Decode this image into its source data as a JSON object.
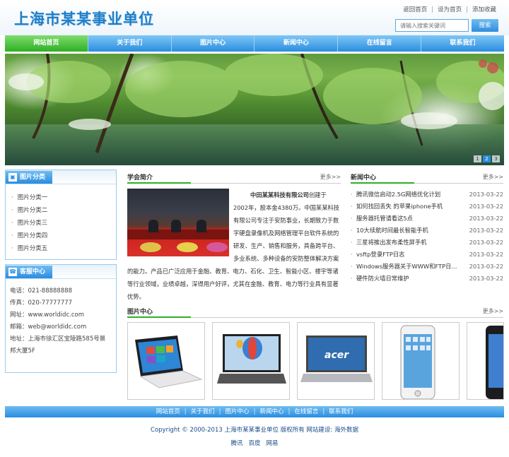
{
  "header": {
    "logo": "上海市某某事业单位",
    "top_links": [
      "返回首页",
      "设为首页",
      "添加收藏"
    ],
    "search_placeholder": "请输入搜索关键词",
    "search_button": "搜索"
  },
  "nav": {
    "items": [
      "网站首页",
      "关于我们",
      "图片中心",
      "新闻中心",
      "在线留言",
      "联系我们"
    ],
    "active_index": 0
  },
  "banner": {
    "pager": [
      "1",
      "2",
      "3"
    ],
    "active_page": 2
  },
  "sidebar": {
    "category_title": "图片分类",
    "categories": [
      "图片分类一",
      "图片分类二",
      "图片分类三",
      "图片分类四",
      "图片分类五"
    ],
    "service_title": "客服中心",
    "service_lines": [
      "电话：021-88888888",
      "传真：020-77777777",
      "网址：www.worldidc.com",
      "邮箱：web@worldidc.com",
      "地址：上海市徐汇区宝陵路585号景",
      "邦大厦5F"
    ]
  },
  "about": {
    "title": "学会简介",
    "more": "更多>>",
    "company": "中田某某科技有限公司",
    "text": "创建于2002年，股本金4380万。中国某某科技有限公司专注于安防事业，长期致力于数字硬盘录像机及网络管理平台软件系统的研发、生产、销售和服务，具备跨平台、多业系统、多种设备的安防整体解决方案的能力。产品已广泛应用于金融、教育、电力、石化、卫生、智能小区、楼宇等诸等行业领域，业绩卓越，深得用户好评，尤其在金融、教育、电力等行业具有显著优势。"
  },
  "news": {
    "title": "新闻中心",
    "more": "更多>>",
    "items": [
      {
        "title": "腾讯微信启动2.5G网络优化计划",
        "date": "2013-03-22"
      },
      {
        "title": "如何找回丢失 的苹果iphone手机",
        "date": "2013-03-22"
      },
      {
        "title": "服务器托管请看这5点",
        "date": "2013-03-22"
      },
      {
        "title": "10大续航时间最长智能手机",
        "date": "2013-03-22"
      },
      {
        "title": "三星将推出发布柔性屏手机",
        "date": "2013-03-22"
      },
      {
        "title": "vsftp登录FTP日志",
        "date": "2013-03-22"
      },
      {
        "title": "Windows服务器关于WWW和FTP日...",
        "date": "2013-03-22"
      },
      {
        "title": "硬件防火墙日常维护",
        "date": "2013-03-22"
      }
    ]
  },
  "products": {
    "title": "图片中心",
    "more": "更多>>",
    "items": [
      "laptop-1",
      "laptop-2",
      "laptop-acer",
      "phone-white",
      "phone-black"
    ]
  },
  "footer": {
    "nav": [
      "网站首页",
      "关于我们",
      "图片中心",
      "新闻中心",
      "在线留言",
      "联系我们"
    ],
    "copyright": "Copyright © 2000-2013 上海市某某事业单位 版权所有  网站建设: 海外数据",
    "links": [
      "腾讯",
      "百度",
      "网易"
    ]
  },
  "colors": {
    "accent_blue": "#2a8de0",
    "accent_green": "#2fae24",
    "logo_blue": "#1e7fc9"
  }
}
